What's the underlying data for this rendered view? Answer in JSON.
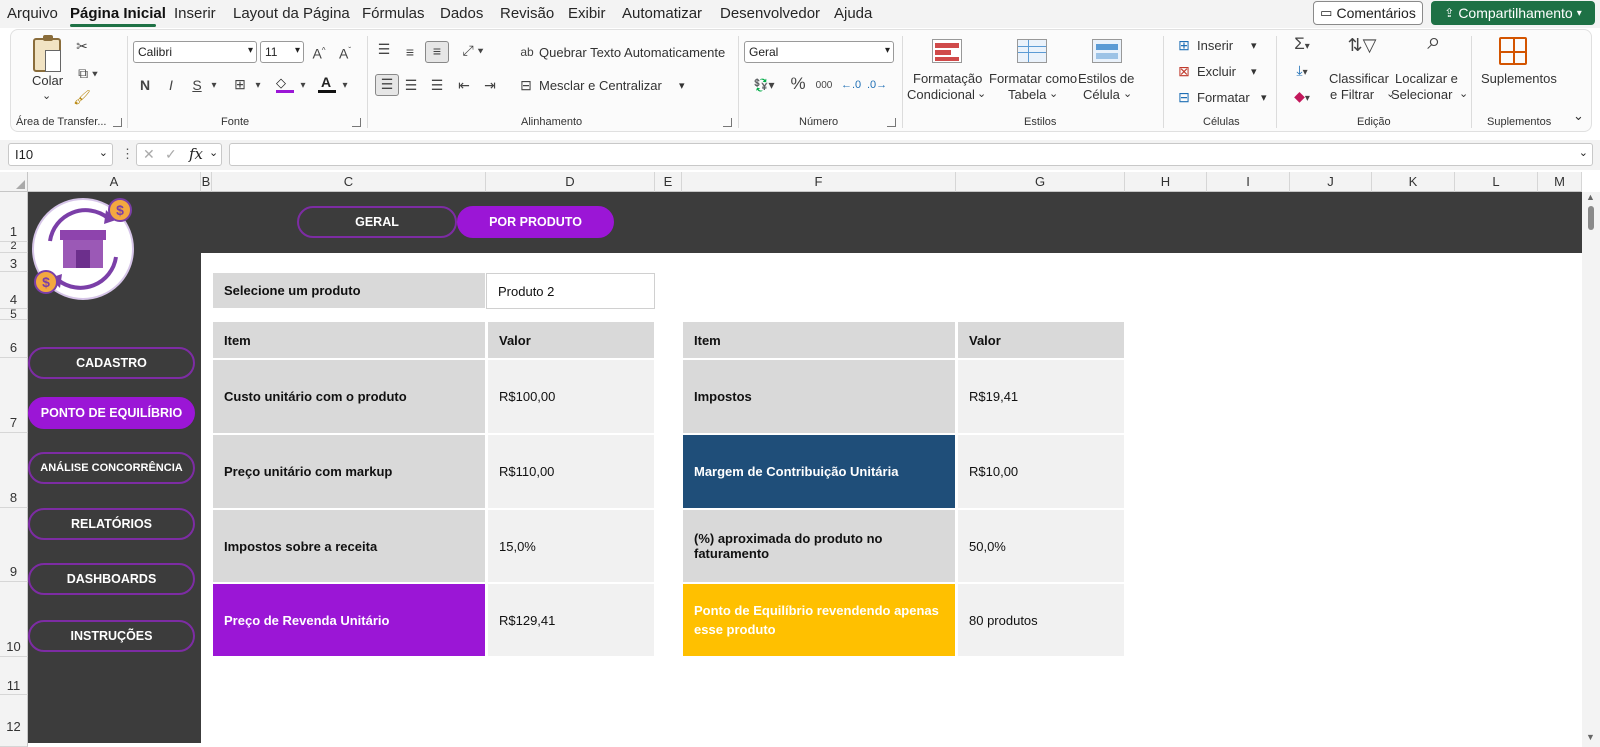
{
  "menu": {
    "tabs": [
      "Arquivo",
      "Página Inicial",
      "Inserir",
      "Layout da Página",
      "Fórmulas",
      "Dados",
      "Revisão",
      "Exibir",
      "Automatizar",
      "Desenvolvedor",
      "Ajuda"
    ],
    "comments": "Comentários",
    "share": "Compartilhamento"
  },
  "ribbon": {
    "clipboard": {
      "paste": "Colar",
      "group": "Área de Transfer..."
    },
    "font": {
      "name": "Calibri",
      "size": "11",
      "group": "Fonte",
      "bold": "N",
      "italic": "I",
      "underline": "S"
    },
    "alignment": {
      "wrap": "Quebrar Texto Automaticamente",
      "merge": "Mesclar e Centralizar",
      "group": "Alinhamento"
    },
    "number": {
      "format": "Geral",
      "group": "Número"
    },
    "styles": {
      "conditional_1": "Formatação",
      "conditional_2": "Condicional",
      "table_1": "Formatar como",
      "table_2": "Tabela",
      "cell_1": "Estilos de",
      "cell_2": "Célula",
      "group": "Estilos"
    },
    "cells": {
      "insert": "Inserir",
      "delete": "Excluir",
      "format": "Formatar",
      "group": "Células"
    },
    "editing": {
      "sort_1": "Classificar",
      "sort_2": "e Filtrar",
      "find_1": "Localizar e",
      "find_2": "Selecionar",
      "group": "Edição"
    },
    "addins": {
      "label": "Suplementos",
      "group": "Suplementos"
    }
  },
  "formula_bar": {
    "name_box": "I10",
    "fx": "fx",
    "formula": ""
  },
  "columns": [
    "A",
    "B",
    "C",
    "D",
    "E",
    "F",
    "G",
    "H",
    "I",
    "J",
    "K",
    "L",
    "M"
  ],
  "rows": [
    "1",
    "2",
    "3",
    "4",
    "5",
    "6",
    "7",
    "8",
    "9",
    "10",
    "11",
    "12"
  ],
  "top_nav": {
    "general": "GERAL",
    "by_product": "POR PRODUTO"
  },
  "side_nav": [
    "CADASTRO",
    "PONTO DE EQUILÍBRIO",
    "ANÁLISE CONCORRÊNCIA",
    "RELATÓRIOS",
    "DASHBOARDS",
    "INSTRUÇÕES"
  ],
  "selector": {
    "label": "Selecione um produto",
    "value": "Produto 2"
  },
  "left_table": {
    "headers": [
      "Item",
      "Valor"
    ],
    "rows": [
      {
        "item": "Custo unitário com o produto",
        "value": "R$100,00"
      },
      {
        "item": "Preço unitário com markup",
        "value": "R$110,00"
      },
      {
        "item": "Impostos sobre a receita",
        "value": "15,0%"
      },
      {
        "item": "Preço de Revenda Unitário",
        "value": "R$129,41"
      }
    ]
  },
  "right_table": {
    "headers": [
      "Item",
      "Valor"
    ],
    "rows": [
      {
        "item": "Impostos",
        "value": "R$19,41"
      },
      {
        "item": "Margem de Contribuição Unitária",
        "value": "R$10,00"
      },
      {
        "item": "(%) aproximada do produto no faturamento",
        "value": "50,0%"
      },
      {
        "item": "Ponto de Equilíbrio revendendo apenas esse produto",
        "value": "80 produtos"
      }
    ]
  },
  "colors": {
    "purple": "#9b16d6",
    "navy": "#1f4e79",
    "gold": "#ffc000",
    "dark": "#3c3c3c",
    "excel_green": "#1e7145"
  }
}
